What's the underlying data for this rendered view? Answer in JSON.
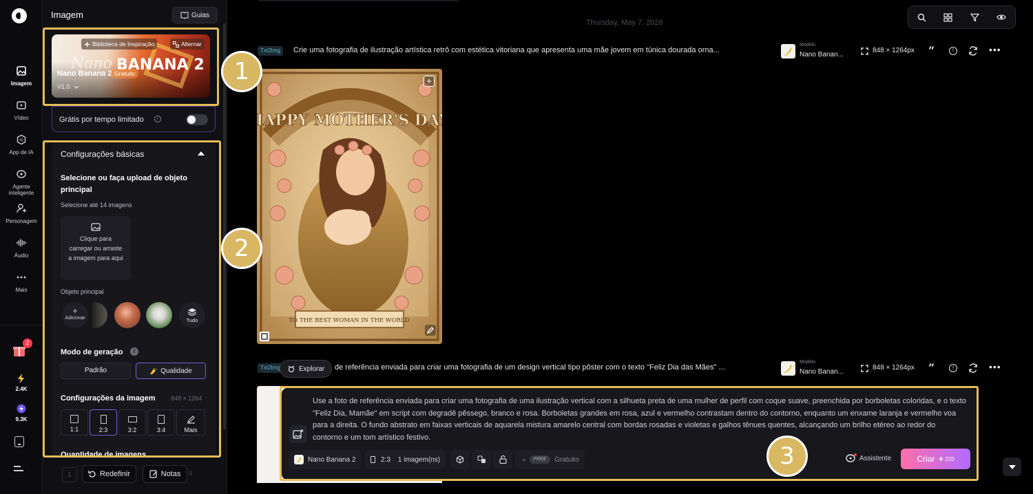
{
  "nav": {
    "items": [
      {
        "label": "Imagem",
        "icon": "image-icon"
      },
      {
        "label": "Vídeo",
        "icon": "video-icon"
      },
      {
        "label": "App de IA",
        "icon": "ai-app-icon"
      },
      {
        "label": "Agente inteligente",
        "icon": "agent-icon"
      },
      {
        "label": "Personagem",
        "icon": "character-icon"
      },
      {
        "label": "Áudio",
        "icon": "audio-icon"
      },
      {
        "label": "Mais",
        "icon": "more-icon"
      }
    ],
    "gift_badge": "2",
    "credits_a": "2.4K",
    "credits_b": "9.3K"
  },
  "panel": {
    "title": "Imagem",
    "guides_label": "Guias",
    "model_card": {
      "inspiration_label": "Biblioteca de Inspiração",
      "switch_label": "Alternar",
      "model_name": "Nano Banana 2",
      "free_badge": "Gratuito",
      "version": "V1.0",
      "banner_script": "Nano",
      "banner_text": "BANANA 2"
    },
    "free_limited_label": "Grátis por tempo limitado",
    "basic_settings_label": "Configurações básicas",
    "upload_title": "Selecione ou faça upload de objeto principal",
    "upload_sub": "Selecione até 14 imagens",
    "upload_box_text": "Clique para carregar ou arraste a imagem para aqui",
    "main_object_label": "Objeto principal",
    "add_label": "Adicionar",
    "all_label": "Tudo",
    "gen_mode_label": "Modo de geração",
    "mode_standard": "Padrão",
    "mode_quality": "Qualidade",
    "image_settings_label": "Configurações da imagem",
    "image_size": "848 × 1264",
    "ratios": [
      "1:1",
      "2:3",
      "3:2",
      "3:4",
      "Mais"
    ],
    "quantity_label": "Quantidade de imagens",
    "reset_label": "Redefinir",
    "notes_label": "Notas"
  },
  "feed": {
    "date": "Thursday, May 7, 2026",
    "entries": [
      {
        "tag": "Txt2Img",
        "prompt": "Crie uma fotografia de ilustração artística retrô com estética vitoriana que apresenta uma mãe jovem em túnica dourada orna...",
        "model_caption": "Modelo",
        "model_name": "Nano Banan...",
        "size": "848 × 1264px"
      },
      {
        "tag": "Txt2Img",
        "prompt": "de referência enviada para criar uma fotografia de um design vertical tipo pôster com o texto \"Feliz Dia das Mães\" ...",
        "model_caption": "Modelo",
        "model_name": "Nano Banan...",
        "size": "848 × 1264px"
      }
    ],
    "poster_top_text": "HAPPY MOTHER'S DAY",
    "poster_bottom_text": "TO THE BEST WOMAN IN THE WORLD",
    "explore_label": "Explorar"
  },
  "composer": {
    "prompt": "Use a foto de referência enviada para criar uma fotografia de uma ilustração vertical com a silhueta preta de uma mulher de perfil com coque suave, preenchida por borboletas coloridas, e o texto \"Feliz Dia, Mamãe\" em script com degradê pêssego, branco e rosa. Borboletas grandes em rosa, azul e vermelho contrastam dentro do contorno, enquanto um enxame laranja e vermelho voa para a direita. O fundo abstrato em faixas verticais de aquarela mistura amarelo central com bordas rosadas e violetas e galhos tênues quentes, alcançando um brilho etéreo ao redor do contorno e um tom artístico festivo.",
    "model_chip": "Nano Banana 2",
    "ratio_chip": "2:3",
    "count_chip": "1 imagem(ns)",
    "free_tag": "FREE",
    "free_label": "Gratuito",
    "assistant_label": "Assistente",
    "create_label": "Criar",
    "create_cost": "220"
  },
  "annotations": [
    "1",
    "2",
    "3"
  ],
  "colors": {
    "highlight": "#e5bd5a",
    "accent": "#7a5fd9",
    "create_from": "#ff6fa8",
    "create_to": "#b06bff"
  }
}
